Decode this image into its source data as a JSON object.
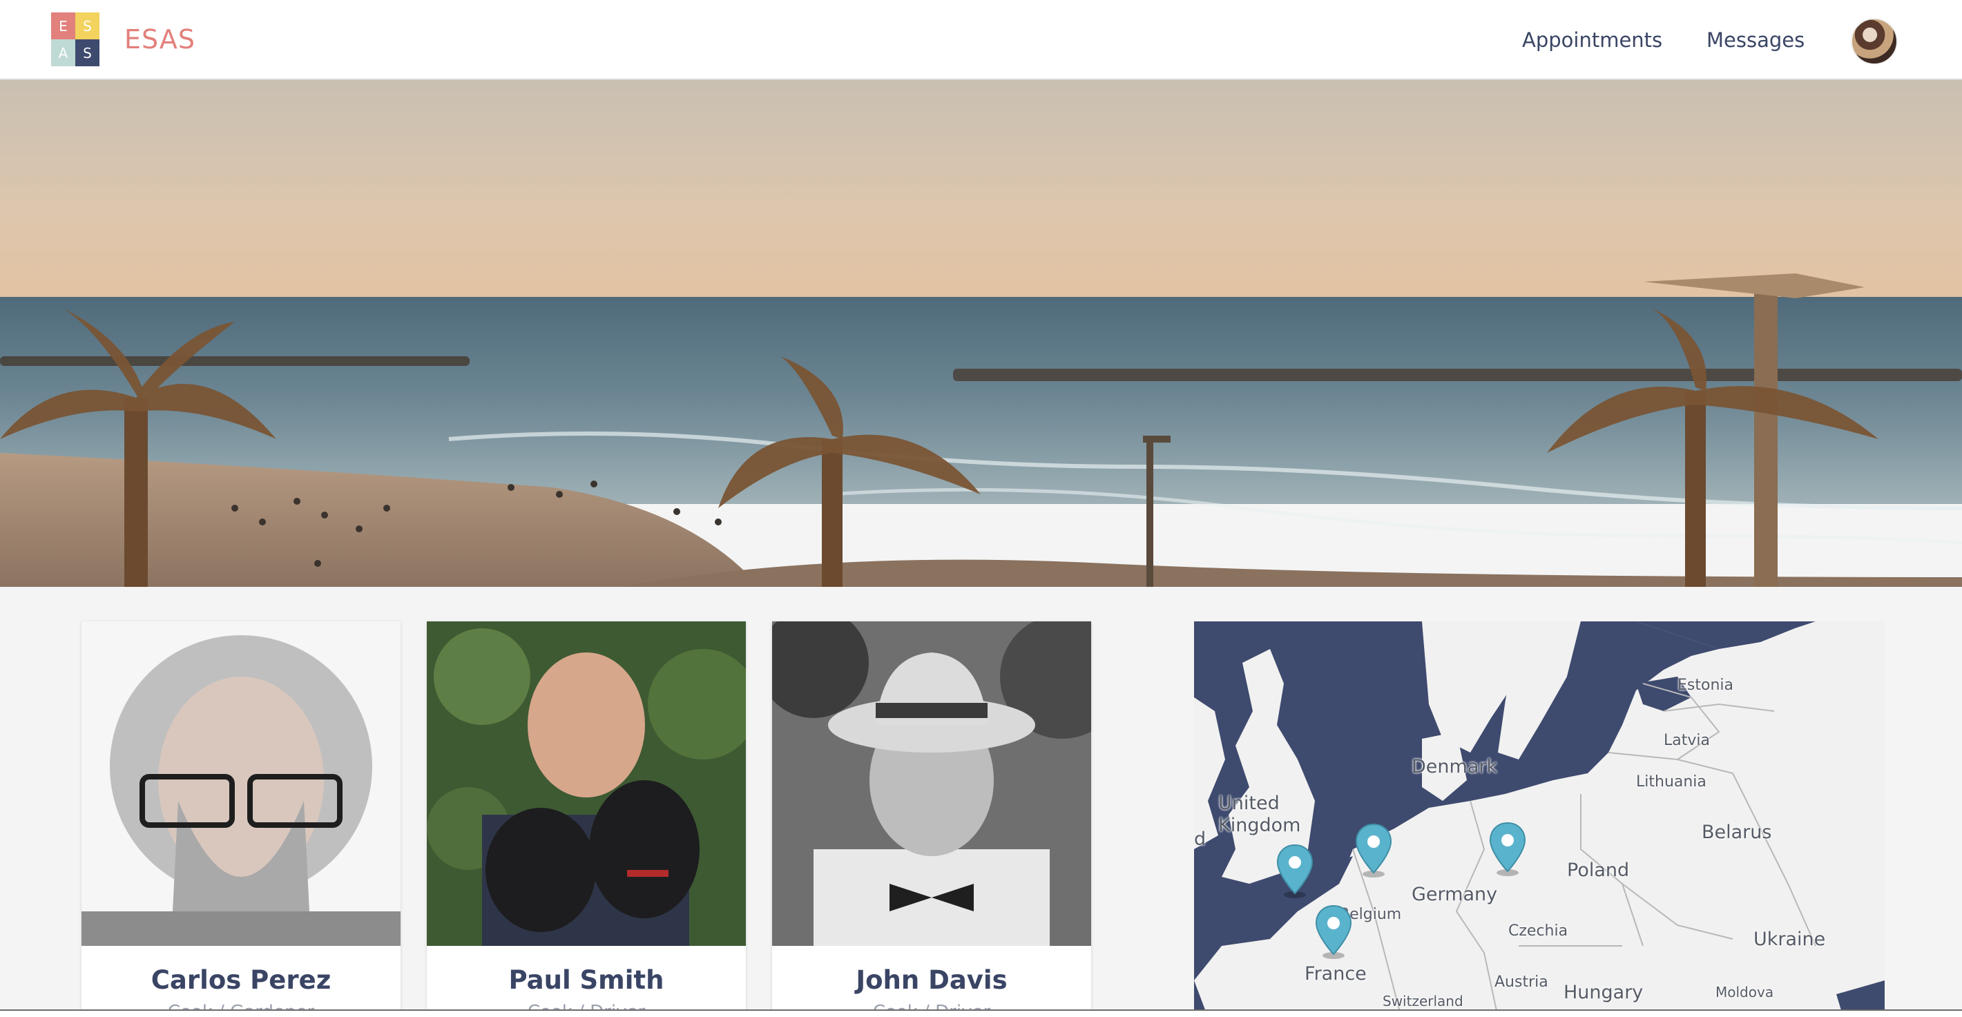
{
  "brand": {
    "name": "ESAS",
    "logo_letters": [
      "E",
      "S",
      "A",
      "S"
    ]
  },
  "nav": {
    "appointments": "Appointments",
    "messages": "Messages"
  },
  "hero": {
    "image": "beach-with-palm-trees"
  },
  "profiles": [
    {
      "name": "Carlos Perez",
      "subtitle": "Cook / Gardener",
      "photo": "man-with-glasses-and-beard"
    },
    {
      "name": "Paul Smith",
      "subtitle": "Cook / Driver",
      "photo": "man-holding-two-dogs"
    },
    {
      "name": "John Davis",
      "subtitle": "Cook / Driver",
      "photo": "man-with-hat-and-bowtie"
    }
  ],
  "map": {
    "labels": {
      "united_kingdom": "United Kingdom",
      "denmark": "Denmark",
      "estonia": "Estonia",
      "latvia": "Latvia",
      "lithuania": "Lithuania",
      "belarus": "Belarus",
      "poland": "Poland",
      "germany": "Germany",
      "belgium": "Belgium",
      "czechia": "Czechia",
      "ukraine": "Ukraine",
      "france": "France",
      "austria": "Austria",
      "hungary": "Hungary",
      "switzerland": "Switzerland",
      "moldova": "Moldova",
      "edge_letter": "d"
    },
    "pin_count": 4
  },
  "colors": {
    "brand": "#e2807c",
    "nav_text": "#3a4565",
    "map_water": "#3e4a6e",
    "map_land": "#f1f1f1",
    "pin": "#5ab3cc"
  }
}
